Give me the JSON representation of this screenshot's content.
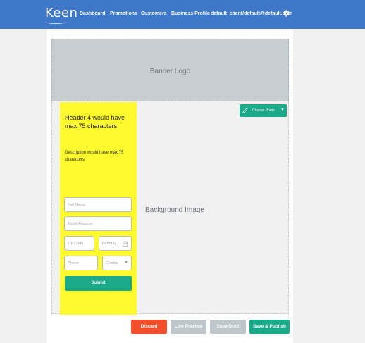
{
  "header": {
    "logo": "Keen",
    "nav": [
      "Dashboard",
      "Promotions",
      "Customers",
      "Business Profile",
      "default_client/default@default.com"
    ],
    "accent_color": "#3f78c9"
  },
  "banner": {
    "label": "Banner Logo"
  },
  "background": {
    "label": "Background Image"
  },
  "choose_photo": {
    "label": "Choose Photo",
    "icon": "pencil-icon",
    "caret_icon": "caret-down-icon"
  },
  "form": {
    "title": "Header 4 would have max 75 characters",
    "description": "Description would have max 75 characters",
    "card_color": "#fefa2e",
    "fields": {
      "full_name": "Full Name",
      "email": "Email Address",
      "zip": "Zip Code",
      "birthday": "Birthday",
      "phone": "Phone",
      "gender": "Gender"
    },
    "submit_label": "Submit"
  },
  "actions": {
    "discard": "Discard",
    "live_preview": "Live Preview",
    "save_draft": "Save Draft",
    "save_publish": "Save & Publish",
    "colors": {
      "discard": "#f2502d",
      "neutral": "#bfc6cc",
      "publish": "#1aaa8a"
    }
  }
}
